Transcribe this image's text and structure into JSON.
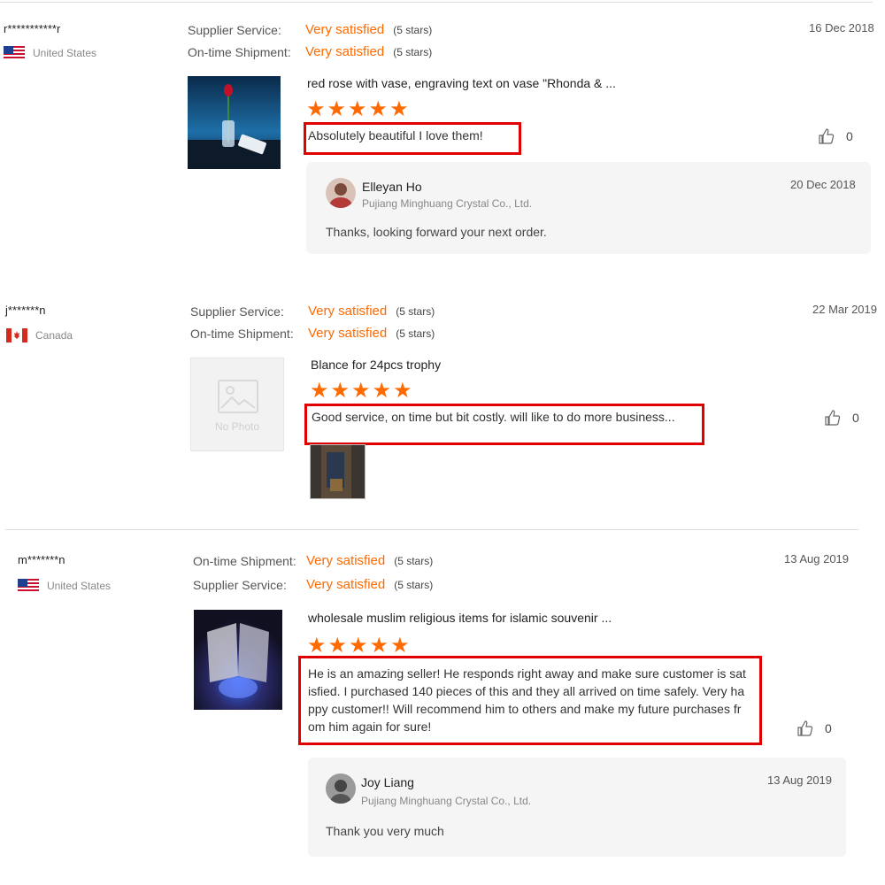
{
  "reviews": [
    {
      "buyer": "r***********r",
      "country": "United States",
      "ratings": [
        {
          "label": "Supplier Service:",
          "value": "Very satisfied",
          "stars": "(5 stars)"
        },
        {
          "label": "On-time Shipment:",
          "value": "Very satisfied",
          "stars": "(5 stars)"
        }
      ],
      "date": "16 Dec 2018",
      "product": "red rose with vase, engraving text on vase \"Rhonda & ...",
      "comment": "Absolutely beautiful I love them!",
      "likes": "0",
      "reply": {
        "name": "Elleyan Ho",
        "company": "Pujiang Minghuang Crystal Co., Ltd.",
        "date": "20 Dec 2018",
        "text": "Thanks, looking forward your next order."
      }
    },
    {
      "buyer": "j*******n",
      "country": "Canada",
      "ratings": [
        {
          "label": "Supplier Service:",
          "value": "Very satisfied",
          "stars": "(5 stars)"
        },
        {
          "label": "On-time Shipment:",
          "value": "Very satisfied",
          "stars": "(5 stars)"
        }
      ],
      "date": "22 Mar 2019",
      "no_photo": "No Photo",
      "product": "Blance for 24pcs trophy",
      "comment": "Good service, on time but bit costly. will like to do more business...",
      "likes": "0"
    },
    {
      "buyer": "m*******n",
      "country": "United States",
      "ratings": [
        {
          "label": "On-time Shipment:",
          "value": "Very satisfied",
          "stars": "(5 stars)"
        },
        {
          "label": "Supplier Service:",
          "value": "Very satisfied",
          "stars": "(5 stars)"
        }
      ],
      "date": "13 Aug 2019",
      "product": "wholesale muslim religious items for islamic souvenir ...",
      "comment_lines": [
        "He is an amazing seller! He responds right away and make sure customer is sat",
        "isfied. I purchased 140 pieces of this and they all arrived on time safely. Very ha",
        "ppy customer!! Will recommend him to others and make my future purchases fr",
        "om him again for sure!"
      ],
      "likes": "0",
      "reply": {
        "name": "Joy Liang",
        "company": "Pujiang Minghuang Crystal Co., Ltd.",
        "date": "13 Aug 2019",
        "text": "Thank you very much"
      }
    }
  ],
  "colors": {
    "accent": "#ff6a00",
    "highlight": "#e10000",
    "reply_bg": "#f5f5f5"
  }
}
